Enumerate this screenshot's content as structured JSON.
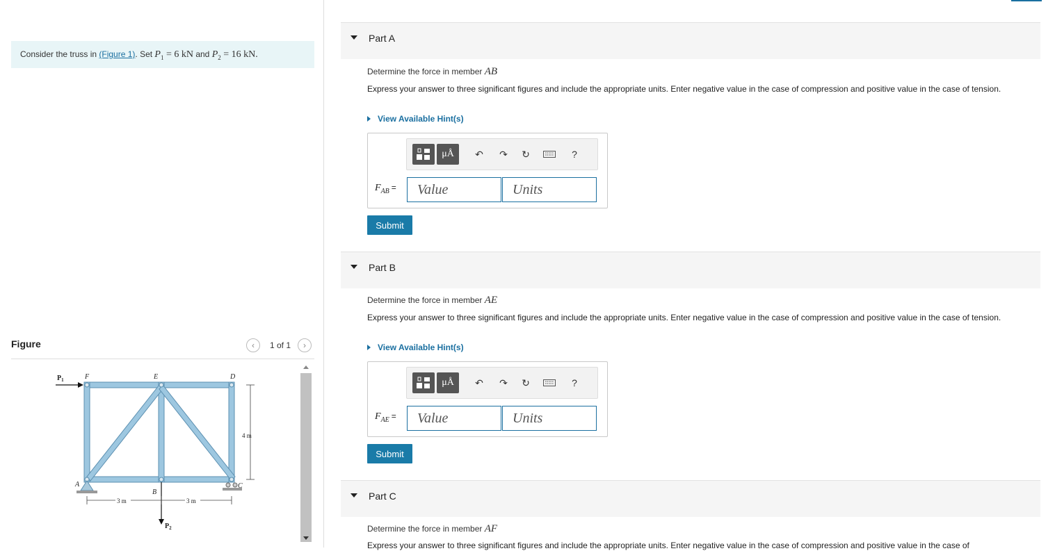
{
  "intro": {
    "prefix": "Consider the truss in ",
    "link": "(Figure 1)",
    "set": ". Set ",
    "p1_sym": "P",
    "p1_sub": "1",
    "p1_val": " = 6 kN",
    "and": " and ",
    "p2_sym": "P",
    "p2_sub": "2",
    "p2_val": " = 16 kN."
  },
  "figure": {
    "title": "Figure",
    "pager": "1 of 1",
    "prev_icon": "chevron-left-icon",
    "next_icon": "chevron-right-icon",
    "labels": {
      "P1": "P",
      "P1_sub": "1",
      "P2": "P",
      "P2_sub": "2",
      "F": "F",
      "E": "E",
      "D": "D",
      "A": "A",
      "B": "B",
      "C": "C",
      "height": "4 m",
      "span1": "3 m",
      "span2": "3 m"
    },
    "colors": {
      "member": "#9dc7e0",
      "member_edge": "#5b8fb0"
    }
  },
  "parts": [
    {
      "label": "Part A",
      "question_prefix": "Determine the force in member ",
      "member": "AB",
      "instructions": "Express your answer to three significant figures and include the appropriate units. Enter negative value in the case of compression and positive value in the case of tension.",
      "hint": "View Available Hint(s)",
      "var": "F",
      "var_sub": "AB",
      "eq": "=",
      "value_placeholder": "Value",
      "units_placeholder": "Units",
      "submit": "Submit"
    },
    {
      "label": "Part B",
      "question_prefix": "Determine the force in member ",
      "member": "AE",
      "instructions": "Express your answer to three significant figures and include the appropriate units. Enter negative value in the case of compression and positive value in the case of tension.",
      "hint": "View Available Hint(s)",
      "var": "F",
      "var_sub": "AE",
      "eq": "=",
      "value_placeholder": "Value",
      "units_placeholder": "Units",
      "submit": "Submit"
    },
    {
      "label": "Part C",
      "question_prefix": "Determine the force in member ",
      "member": "AF",
      "instructions": "Express your answer to three significant figures and include the appropriate units. Enter negative value in the case of compression and positive value in the case of"
    }
  ],
  "toolbar": {
    "templates_icon": "templates-icon",
    "units_label": "μÅ",
    "undo_icon": "undo-icon",
    "redo_icon": "redo-icon",
    "reset_icon": "reset-icon",
    "keyboard_icon": "keyboard-icon",
    "help_label": "?"
  }
}
